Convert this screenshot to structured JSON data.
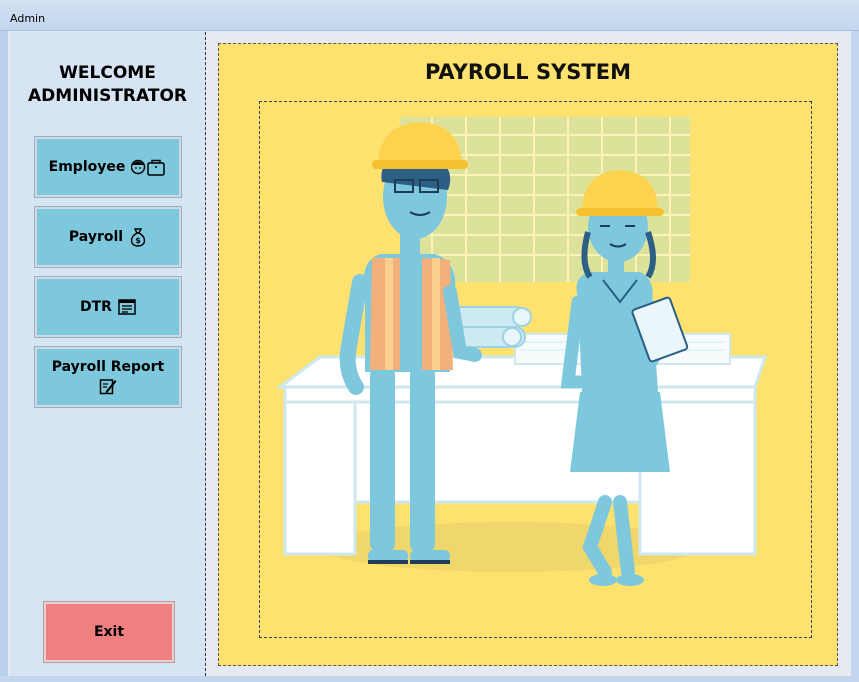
{
  "window": {
    "title": "Admin"
  },
  "sidebar": {
    "welcome_line1": "WELCOME",
    "welcome_line2": "ADMINISTRATOR",
    "buttons": [
      {
        "label": "Employee",
        "icon": "employee-icon"
      },
      {
        "label": "Payroll",
        "icon": "money-bag-icon"
      },
      {
        "label": "DTR",
        "icon": "report-icon"
      },
      {
        "label": "Payroll Report",
        "icon": "edit-document-icon"
      }
    ],
    "exit_label": "Exit"
  },
  "main": {
    "title": "PAYROLL SYSTEM",
    "illustration": "workers-at-desk-illustration"
  },
  "colors": {
    "sidebar_bg": "#d6e4f3",
    "nav_button": "#7ec8dd",
    "exit_button": "#f08080",
    "main_bg": "#fde270",
    "figure_blue": "#7ec8dd",
    "vest_orange": "#f4b07a",
    "helmet_yellow": "#fdd34e"
  }
}
